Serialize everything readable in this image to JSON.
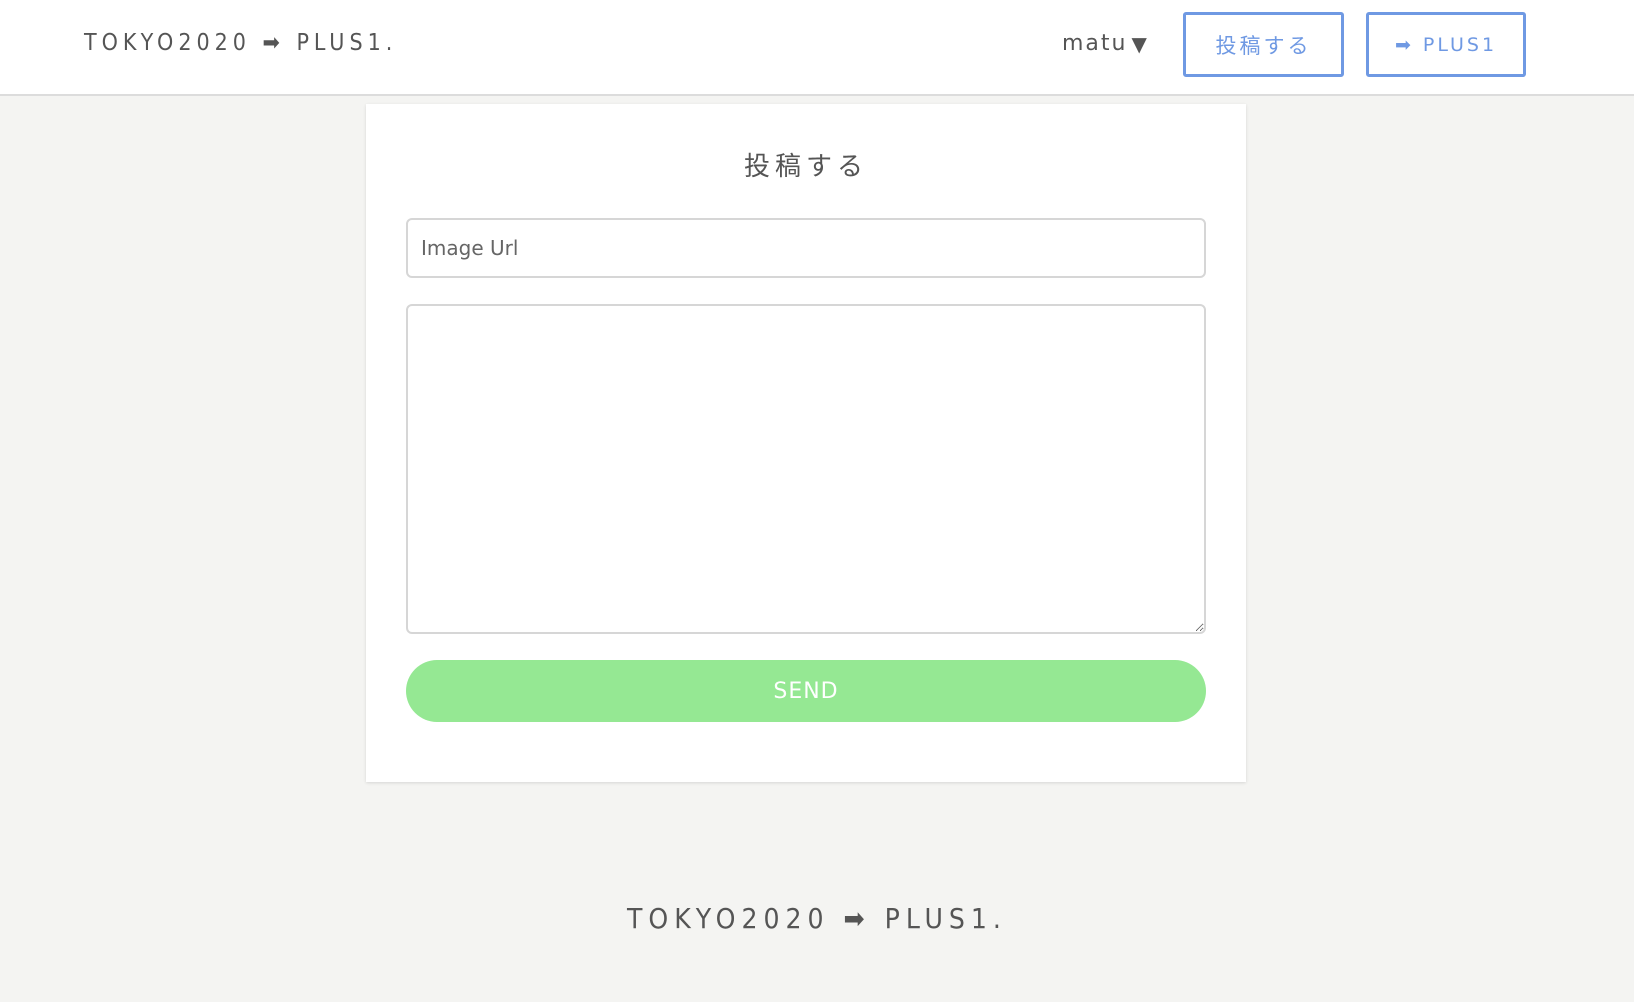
{
  "header": {
    "logo": "TOKYO2020 ➡ PLUS1.",
    "user_name": "matu",
    "user_caret": "▼",
    "post_button": "投稿する",
    "plus_button": "➡ PLUS1"
  },
  "form": {
    "title": "投稿する",
    "image_url_placeholder": "Image Url",
    "image_url_value": "",
    "body_value": "",
    "send_label": "SEND"
  },
  "footer": {
    "logo": "TOKYO2020 ➡ PLUS1."
  },
  "colors": {
    "accent_blue": "#6f99e3",
    "send_green": "#95e893",
    "background": "#f4f4f2"
  }
}
